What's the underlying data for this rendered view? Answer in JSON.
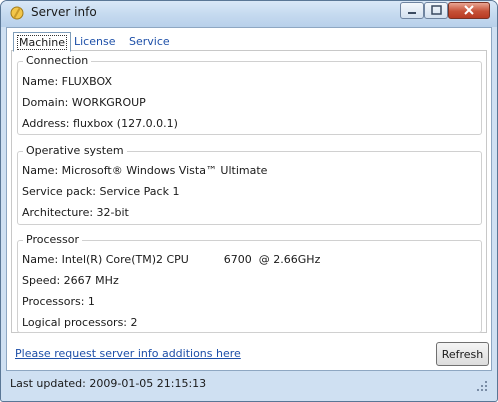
{
  "window": {
    "title": "Server info"
  },
  "tabs": [
    {
      "label": "Machine",
      "active": true
    },
    {
      "label": "License",
      "active": false
    },
    {
      "label": "Service",
      "active": false
    }
  ],
  "groups": {
    "connection": {
      "title": "Connection",
      "rows": [
        "Name: FLUXBOX",
        "Domain: WORKGROUP",
        "Address: fluxbox (127.0.0.1)"
      ]
    },
    "os": {
      "title": "Operative system",
      "rows": [
        "Name: Microsoft® Windows Vista™ Ultimate",
        "Service pack: Service Pack 1",
        "Architecture: 32-bit"
      ]
    },
    "processor": {
      "title": "Processor",
      "rows": [
        "Name: Intel(R) Core(TM)2 CPU          6700  @ 2.66GHz",
        "Speed: 2667 MHz",
        "Processors: 1",
        "Logical processors: 2"
      ]
    }
  },
  "footer": {
    "link": "Please request server info additions here",
    "refresh_label": "Refresh"
  },
  "statusbar": {
    "text": "Last updated: 2009-01-05 21:15:13"
  },
  "colors": {
    "link": "#1d4fa8",
    "titlebar": "#c4d9ef",
    "close_button": "#c65137"
  },
  "icons": [
    "app-icon",
    "minimize-icon",
    "maximize-icon",
    "close-icon",
    "resize-grip-icon"
  ]
}
